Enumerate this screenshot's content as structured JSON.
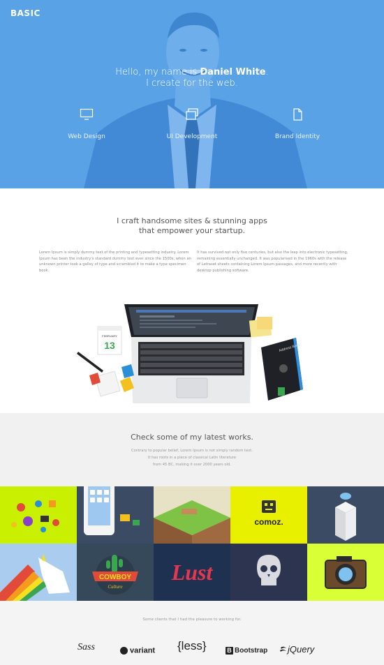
{
  "brand": {
    "logo": "BASIC"
  },
  "hero": {
    "greeting_prefix": "Hello, my name is ",
    "name": "Daniel White",
    "greeting_suffix": ".",
    "tagline": "I create for the web.",
    "services": [
      {
        "label": "Web Design",
        "icon": "monitor-icon"
      },
      {
        "label": "UI Development",
        "icon": "windows-icon"
      },
      {
        "label": "Brand Identity",
        "icon": "document-icon"
      }
    ]
  },
  "intro": {
    "heading_line1": "I craft handsome sites & stunning apps",
    "heading_line2": "that empower your startup.",
    "col_left": "Lorem Ipsum is simply dummy text of the printing and typesetting industry. Lorem Ipsum has been the industry's standard dummy text ever since the 1500s, when an unknown printer took a galley of type and scrambled it to make a type specimen book.",
    "col_right": "It has survived not only five centuries, but also the leap into electronic typesetting, remaining essentially unchanged. It was popularised in the 1960s with the release of Letraset sheets containing Lorem Ipsum passages, and more recently with desktop publishing software."
  },
  "illustration": {
    "calendar_month": "FEBRUARY",
    "calendar_day": "13",
    "book_label": "Address Book"
  },
  "works": {
    "title": "Check some of my latest works.",
    "desc_line1": "Contrary to popular belief, Lorem Ipsum is not simply random text.",
    "desc_line2": "It has roots in a piece of classical Latin literature",
    "desc_line3": "from 45 BC, making it over 2000 years old.",
    "tiles": [
      {
        "name": "icons-tile",
        "color": "#c8f000"
      },
      {
        "name": "phone-tile",
        "color": "#3a4b63"
      },
      {
        "name": "landscape-tile",
        "color": "#e7e2c6"
      },
      {
        "name": "comoz-tile",
        "color": "#e8f000",
        "label": "comoz."
      },
      {
        "name": "fridge-tile",
        "color": "#3a4b63"
      },
      {
        "name": "unicorn-tile",
        "color": "#a9ccef"
      },
      {
        "name": "cowboy-tile",
        "color": "#35495a",
        "label_top": "COWBOY",
        "label_bottom": "Culture"
      },
      {
        "name": "lust-tile",
        "color": "#1e3150",
        "label": "Lust"
      },
      {
        "name": "skull-tile",
        "color": "#2c3450"
      },
      {
        "name": "camera-tile",
        "color": "#d9ff36"
      }
    ]
  },
  "clients": {
    "title": "Some clients that I had the pleasure to working for.",
    "logos": [
      {
        "label": "Sass"
      },
      {
        "label": "variant"
      },
      {
        "label": "{less}"
      },
      {
        "label": "Bootstrap",
        "mark": "B"
      },
      {
        "label": "jQuery"
      }
    ]
  }
}
